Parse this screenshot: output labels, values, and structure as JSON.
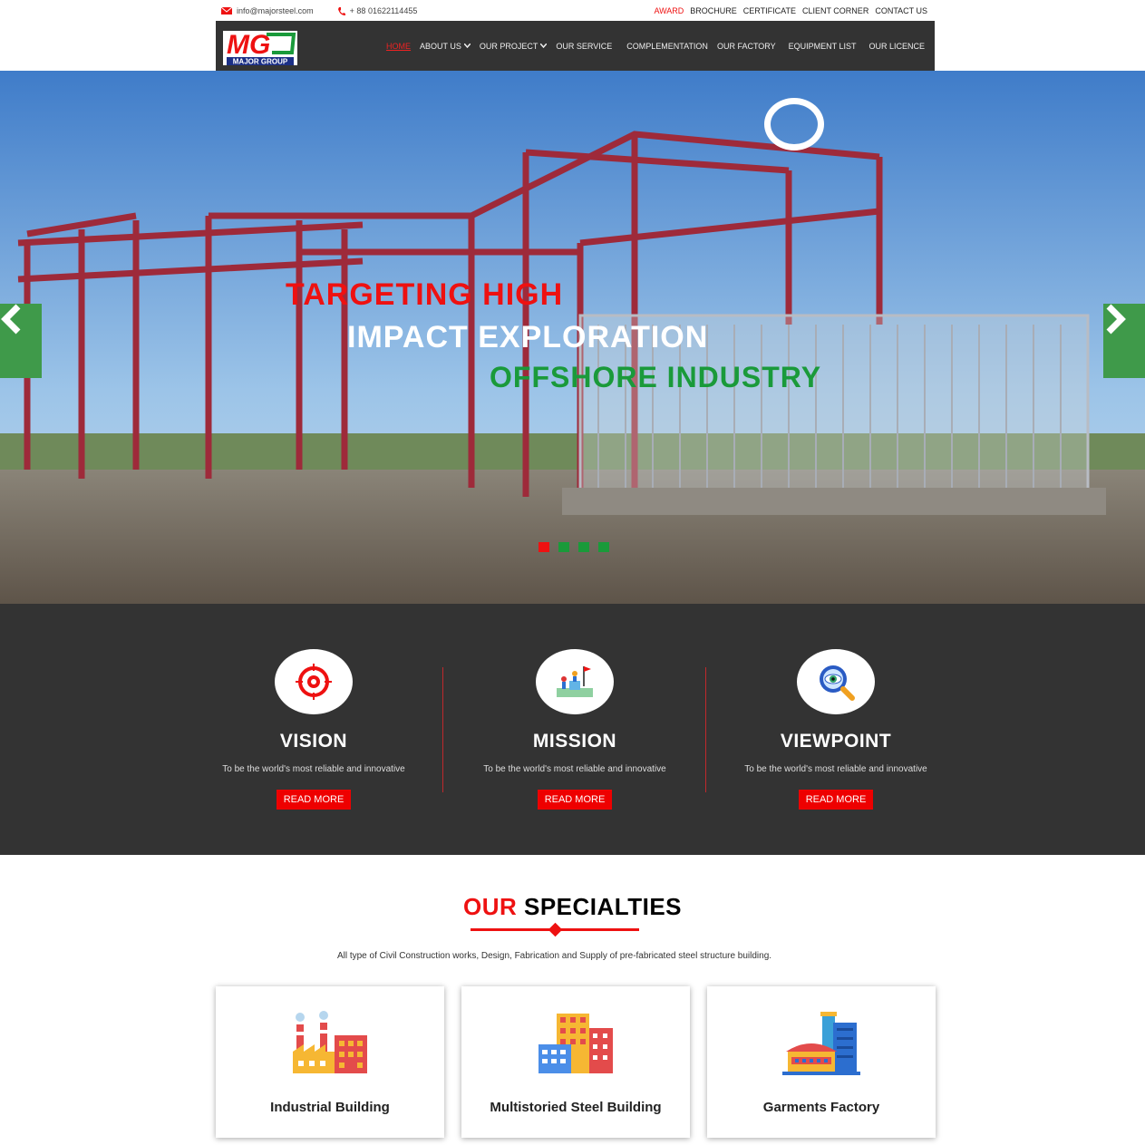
{
  "topbar": {
    "email": "info@majorsteel.com",
    "phone": "+ 88 01622114455",
    "links": [
      "AWARD",
      "BROCHURE",
      "CERTIFICATE",
      "CLIENT CORNER",
      "CONTACT US"
    ]
  },
  "logo": {
    "letters": "MG",
    "name": "MAJOR GROUP"
  },
  "nav": {
    "items": [
      "HOME",
      "ABOUT US",
      "OUR PROJECT",
      "OUR SERVICE",
      "COMPLEMENTATION",
      "OUR FACTORY",
      "EQUIPMENT LIST",
      "OUR LICENCE"
    ]
  },
  "hero": {
    "line1": "TARGETING HIGH",
    "line2": "IMPACT EXPLORATION",
    "line3": "OFFSHORE INDUSTRY",
    "slide_count": 4,
    "active_slide": 1
  },
  "features": [
    {
      "title": "VISION",
      "text": "To be the world's most reliable and innovative",
      "button": "READ MORE",
      "icon": "target-icon"
    },
    {
      "title": "MISSION",
      "text": "To be the world's most reliable and innovative",
      "button": "READ MORE",
      "icon": "team-climb-icon"
    },
    {
      "title": "VIEWPOINT",
      "text": "To be the world's most reliable and innovative",
      "button": "READ MORE",
      "icon": "magnifier-eye-icon"
    }
  ],
  "specialties": {
    "title_red": "OUR",
    "title_black": "SPECIALTIES",
    "subtitle": "All type of Civil Construction works, Design, Fabrication and Supply of pre-fabricated steel structure building.",
    "cards": [
      {
        "label": "Industrial Building",
        "icon": "factory-icon"
      },
      {
        "label": "Multistoried Steel Building",
        "icon": "buildings-icon"
      },
      {
        "label": "Garments Factory",
        "icon": "warehouse-icon"
      }
    ]
  },
  "colors": {
    "accent": "#e11111",
    "green": "#1a9a3a",
    "dark": "#333333"
  }
}
